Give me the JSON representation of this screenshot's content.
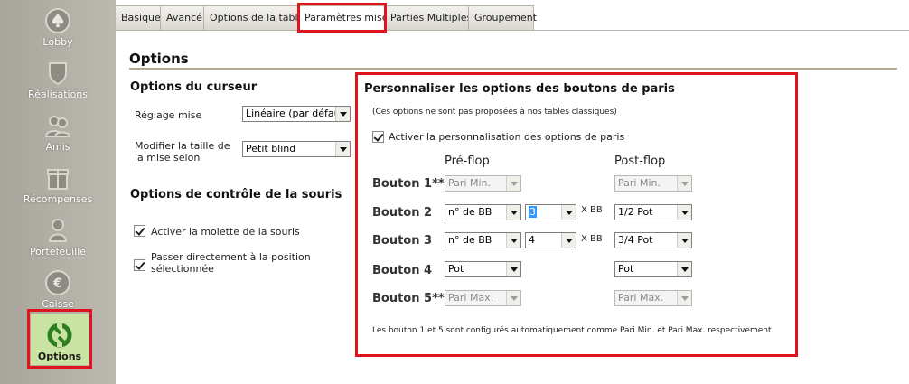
{
  "sidebar": {
    "items": [
      {
        "label": "Lobby",
        "icon": "spade-icon"
      },
      {
        "label": "Réalisations",
        "icon": "shield-icon"
      },
      {
        "label": "Amis",
        "icon": "friends-icon"
      },
      {
        "label": "Récompenses",
        "icon": "gift-icon"
      },
      {
        "label": "Portefeuille",
        "icon": "wallet-user-icon"
      },
      {
        "label": "Caisse",
        "icon": "euro-coin-icon"
      },
      {
        "label": "Options",
        "icon": "wrench-gear-icon"
      }
    ],
    "active_color": "#c9e3a2"
  },
  "tabs": [
    {
      "label": "Basique"
    },
    {
      "label": "Avancé"
    },
    {
      "label": "Options de la table"
    },
    {
      "label": "Paramètres mise",
      "active": true
    },
    {
      "label": "Parties Multiples"
    },
    {
      "label": "Groupement"
    }
  ],
  "page_title": "Options",
  "cursor_options": {
    "title": "Options du curseur",
    "bet_setting_label": "Réglage mise",
    "bet_setting_value": "Linéaire (par défaut)",
    "modify_size_label": "Modifier la taille de la mise selon",
    "modify_size_value": "Petit blind"
  },
  "mouse_options": {
    "title": "Options de contrôle de la souris",
    "wheel_label": "Activer la molette de la souris",
    "direct_label": "Passer directement à la position sélectionnée"
  },
  "bet_buttons": {
    "title": "Personnaliser les options des boutons de paris",
    "note": "(Ces options ne sont pas proposées à nos tables classiques)",
    "enable_label": "Activer la personnalisation des options de paris",
    "preflop_header": "Pré-flop",
    "postflop_header": "Post-flop",
    "rows": [
      {
        "label": "Bouton 1**",
        "pre": "Pari Min.",
        "pre_amount": "",
        "post": "Pari Min."
      },
      {
        "label": "Bouton 2",
        "pre": "n° de BB",
        "pre_amount": "3",
        "post": "1/2 Pot"
      },
      {
        "label": "Bouton 3",
        "pre": "n° de BB",
        "pre_amount": "4",
        "post": "3/4 Pot"
      },
      {
        "label": "Bouton 4",
        "pre": "Pot",
        "pre_amount": "",
        "post": "Pot"
      },
      {
        "label": "Bouton 5**",
        "pre": "Pari Max.",
        "pre_amount": "",
        "post": "Pari Max."
      }
    ],
    "xbb": "X BB",
    "footnote": "Les bouton 1 et 5 sont configurés automatiquement comme Pari Min. et Pari Max. respectivement."
  },
  "highlight_color": "#e0141c"
}
